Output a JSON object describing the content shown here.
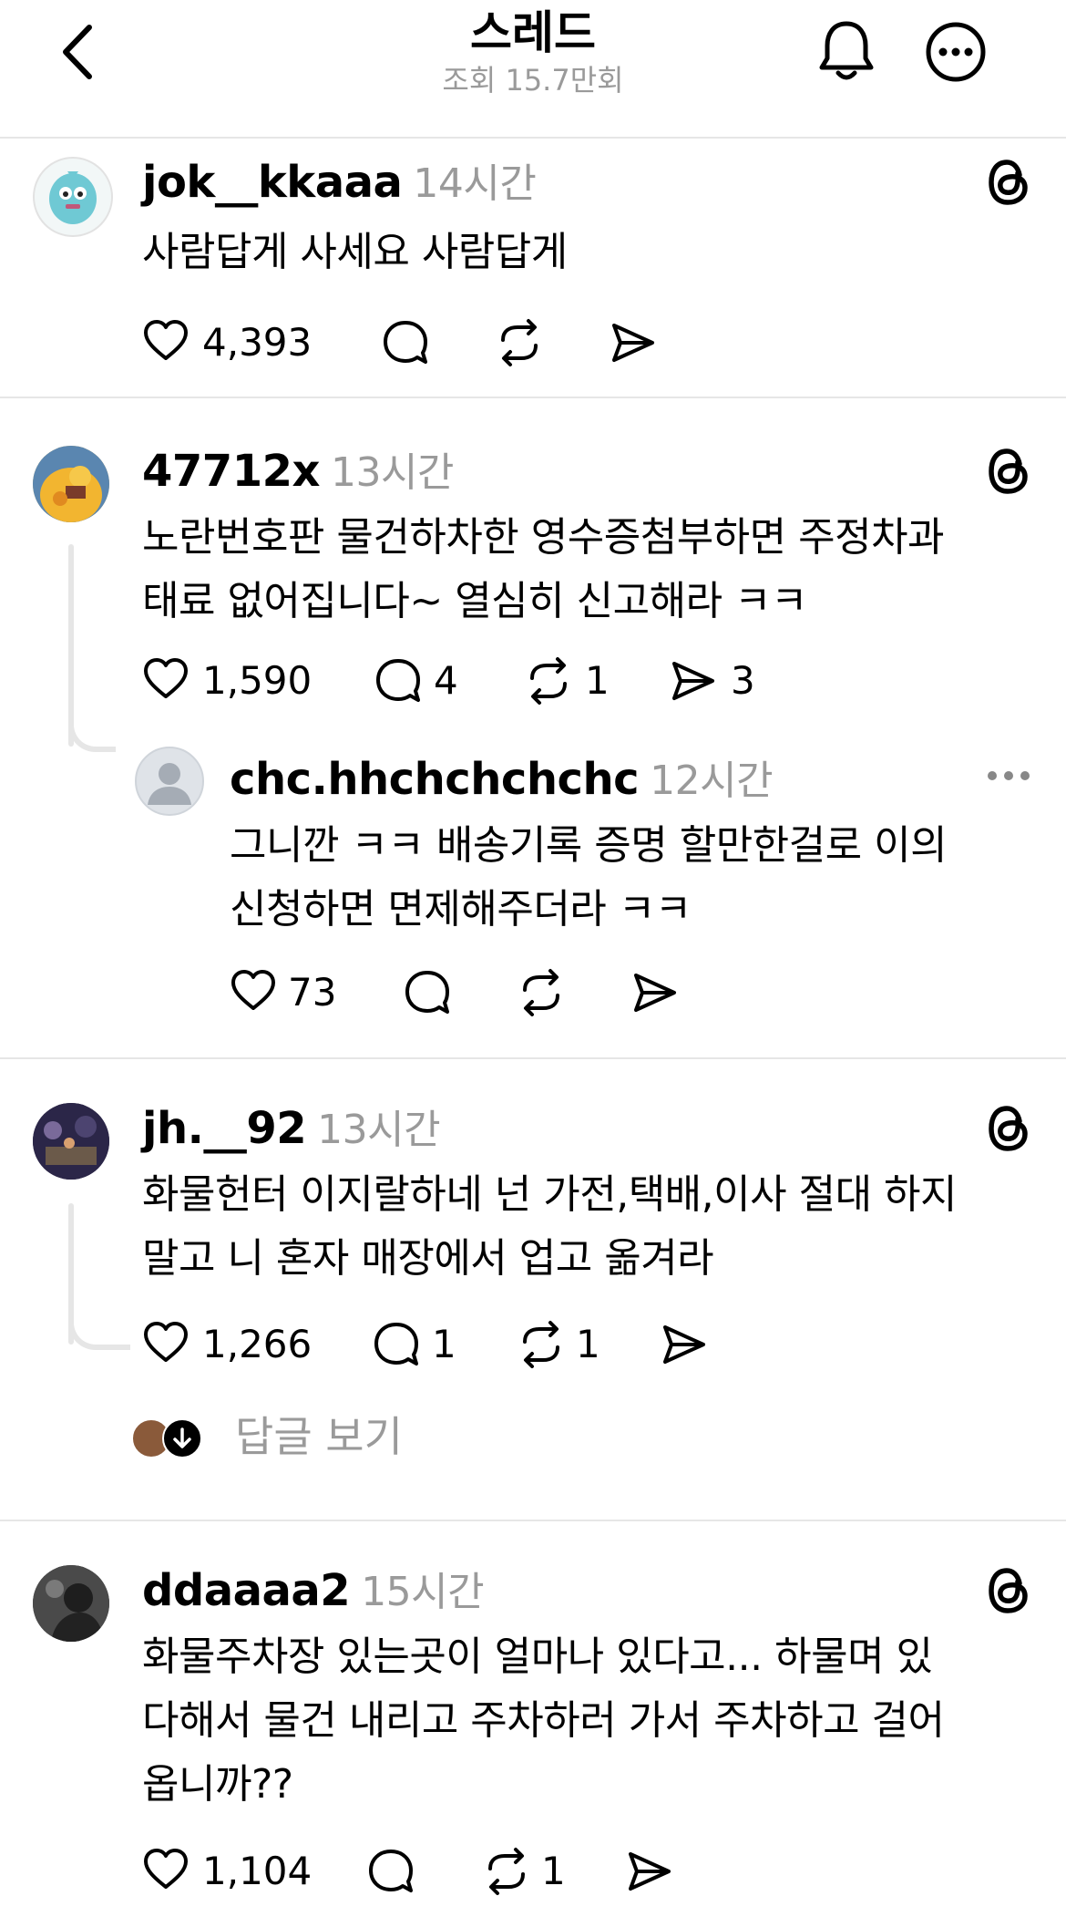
{
  "header": {
    "title": "스레드",
    "views": "조회 15.7만회",
    "back_icon": "chevron-left-icon",
    "bell_icon": "bell-icon",
    "more_icon": "more-circle-icon"
  },
  "comments": [
    {
      "username": "jok__kkaaa",
      "time": "14시간",
      "text_lines": [
        "사람답게 사세요 사람답게"
      ],
      "likes": "4,393",
      "replies": "",
      "reposts": "",
      "shares": ""
    },
    {
      "username": "47712x",
      "time": "13시간",
      "text_lines": [
        "노란번호판 물건하차한 영수증첨부하면 주정차과",
        "태료 없어집니다~ 열심히 신고해라 ㅋㅋ"
      ],
      "likes": "1,590",
      "replies": "4",
      "reposts": "1",
      "shares": "3"
    },
    {
      "username": "chc.hhchchchchc",
      "time": "12시간",
      "text_lines": [
        "그니깐 ㅋㅋ 배송기록 증명 할만한걸로 이의",
        "신청하면 면제해주더라 ㅋㅋ"
      ],
      "likes": "73",
      "replies": "",
      "reposts": "",
      "shares": ""
    },
    {
      "username": "jh.__92",
      "time": "13시간",
      "text_lines": [
        "화물헌터 이지랄하네 넌 가전,택배,이사 절대 하지",
        "말고 니 혼자 매장에서 업고 옮겨라"
      ],
      "likes": "1,266",
      "replies": "1",
      "reposts": "1",
      "shares": "",
      "view_replies": "답글 보기"
    },
    {
      "username": "ddaaaa2",
      "time": "15시간",
      "text_lines": [
        "화물주차장 있는곳이 얼마나 있다고... 하물며 있",
        "다해서 물건 내리고 주차하러 가서 주차하고 걸어",
        "옵니까??"
      ],
      "likes": "1,104",
      "replies": "",
      "reposts": "1",
      "shares": ""
    }
  ],
  "colors": {
    "secondary_text": "#9a9a9a",
    "divider": "#e6e6e6",
    "threads_logo": "#000000"
  }
}
